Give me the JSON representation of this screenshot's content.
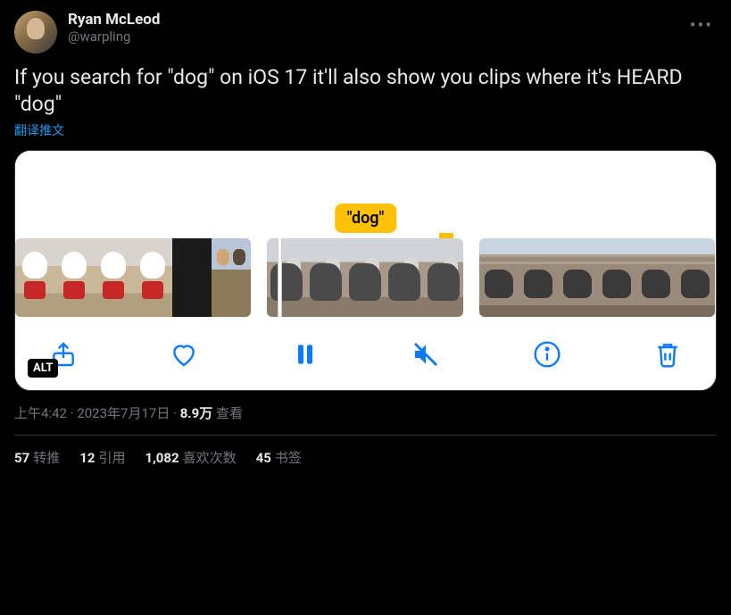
{
  "author": {
    "display_name": "Ryan McLeod",
    "handle": "@warpling"
  },
  "tweet_text": "If you search for \"dog\" on iOS 17 it'll also show you clips where it's HEARD \"dog\"",
  "translate_label": "翻译推文",
  "media": {
    "badge_text": "\"dog\"",
    "alt_label": "ALT",
    "toolbar": {
      "share": "share",
      "like": "like",
      "pause": "pause",
      "mute": "mute",
      "info": "info",
      "trash": "trash"
    }
  },
  "meta": {
    "time": "上午4:42",
    "sep1": " · ",
    "date": "2023年7月17日",
    "sep2": " · ",
    "views_count": "8.9万",
    "views_label": " 查看"
  },
  "stats": {
    "retweets_count": "57",
    "retweets_label": "转推",
    "quotes_count": "12",
    "quotes_label": "引用",
    "likes_count": "1,082",
    "likes_label": "喜欢次数",
    "bookmarks_count": "45",
    "bookmarks_label": "书签"
  }
}
